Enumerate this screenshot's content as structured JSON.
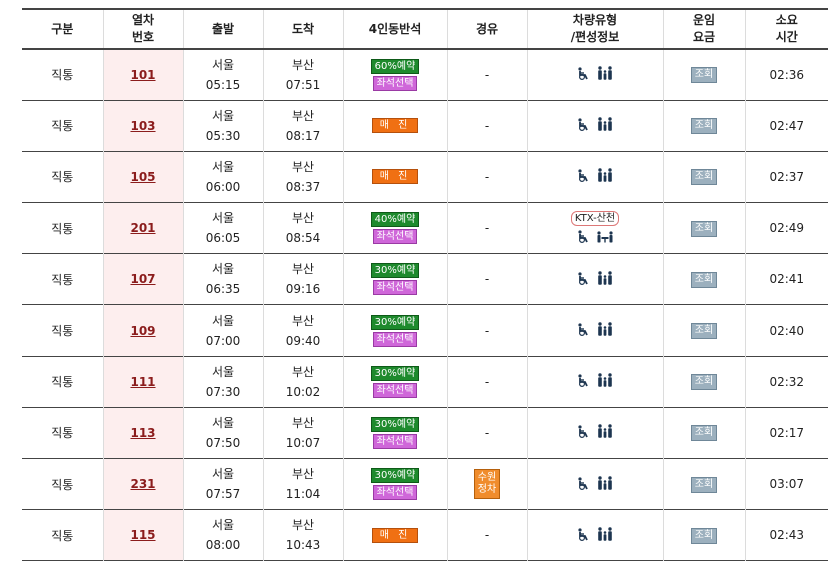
{
  "headers": {
    "type": "구분",
    "train_no": [
      "열차",
      "번호"
    ],
    "depart": "출발",
    "arrive": "도착",
    "family_seat": "4인동반석",
    "via": "경유",
    "car_type": [
      "차량유형",
      "/편성정보"
    ],
    "fare": [
      "운임",
      "요금"
    ],
    "duration": [
      "소요",
      "시간"
    ]
  },
  "rows": [
    {
      "type": "직통",
      "train_no": "101",
      "from": "서울",
      "dep": "05:15",
      "to": "부산",
      "arr": "07:51",
      "status": "60%예약",
      "seat": "좌석선택",
      "via": "-",
      "ktx": "",
      "fare": "조회",
      "dur": "02:36"
    },
    {
      "type": "직통",
      "train_no": "103",
      "from": "서울",
      "dep": "05:30",
      "to": "부산",
      "arr": "08:17",
      "status": "매 진",
      "seat": "",
      "via": "-",
      "ktx": "",
      "fare": "조회",
      "dur": "02:47"
    },
    {
      "type": "직통",
      "train_no": "105",
      "from": "서울",
      "dep": "06:00",
      "to": "부산",
      "arr": "08:37",
      "status": "매 진",
      "seat": "",
      "via": "-",
      "ktx": "",
      "fare": "조회",
      "dur": "02:37"
    },
    {
      "type": "직통",
      "train_no": "201",
      "from": "서울",
      "dep": "06:05",
      "to": "부산",
      "arr": "08:54",
      "status": "40%예약",
      "seat": "좌석선택",
      "via": "-",
      "ktx": "KTX-산천",
      "fare": "조회",
      "dur": "02:49"
    },
    {
      "type": "직통",
      "train_no": "107",
      "from": "서울",
      "dep": "06:35",
      "to": "부산",
      "arr": "09:16",
      "status": "30%예약",
      "seat": "좌석선택",
      "via": "-",
      "ktx": "",
      "fare": "조회",
      "dur": "02:41"
    },
    {
      "type": "직통",
      "train_no": "109",
      "from": "서울",
      "dep": "07:00",
      "to": "부산",
      "arr": "09:40",
      "status": "30%예약",
      "seat": "좌석선택",
      "via": "-",
      "ktx": "",
      "fare": "조회",
      "dur": "02:40"
    },
    {
      "type": "직통",
      "train_no": "111",
      "from": "서울",
      "dep": "07:30",
      "to": "부산",
      "arr": "10:02",
      "status": "30%예약",
      "seat": "좌석선택",
      "via": "-",
      "ktx": "",
      "fare": "조회",
      "dur": "02:32"
    },
    {
      "type": "직통",
      "train_no": "113",
      "from": "서울",
      "dep": "07:50",
      "to": "부산",
      "arr": "10:07",
      "status": "30%예약",
      "seat": "좌석선택",
      "via": "-",
      "ktx": "",
      "fare": "조회",
      "dur": "02:17"
    },
    {
      "type": "직통",
      "train_no": "231",
      "from": "서울",
      "dep": "07:57",
      "to": "부산",
      "arr": "11:04",
      "status": "30%예약",
      "seat": "좌석선택",
      "via": "수원 정차",
      "ktx": "",
      "fare": "조회",
      "dur": "03:07"
    },
    {
      "type": "직통",
      "train_no": "115",
      "from": "서울",
      "dep": "08:00",
      "to": "부산",
      "arr": "10:43",
      "status": "매 진",
      "seat": "",
      "via": "-",
      "ktx": "",
      "fare": "조회",
      "dur": "02:43"
    }
  ],
  "icons": {
    "car_type": [
      "wheelchair-icon",
      "family-icon"
    ],
    "car_type_alt": [
      "wheelchair-icon",
      "table-family-icon"
    ]
  },
  "colors": {
    "train_no_bg": "#fdeeee",
    "train_no_text": "#8b1c1c",
    "reserve_green": "#1e8a2d",
    "seat_select": "#cf67d9",
    "sold_out": "#f07013",
    "via_orange": "#f08c2c",
    "lookup_btn": "#9cb0be"
  }
}
